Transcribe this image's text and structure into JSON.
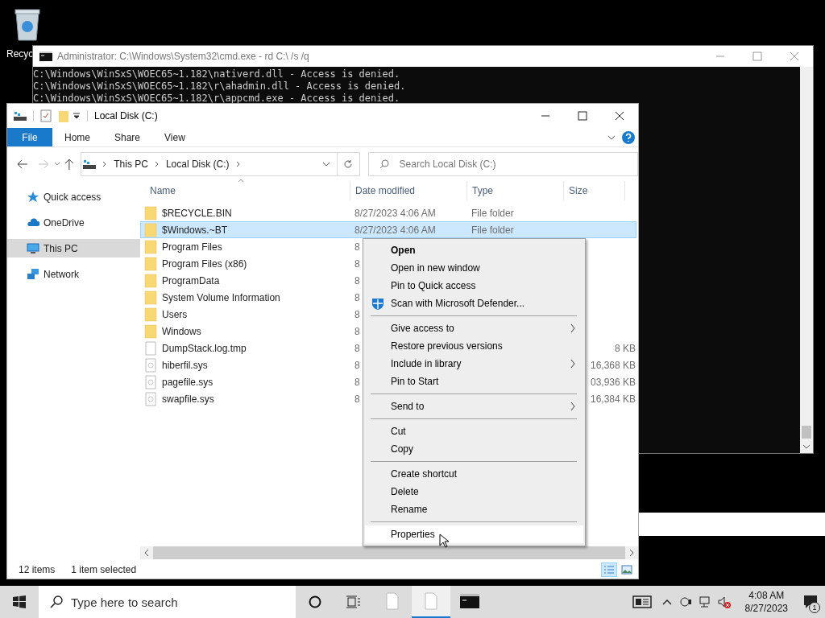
{
  "desktop": {
    "icons": [
      {
        "label": "Recyc"
      }
    ]
  },
  "console": {
    "title": "Administrator: C:\\Windows\\System32\\cmd.exe - rd  C:\\ /s /q",
    "lines": [
      "C:\\Windows\\WinSxS\\WOEC65~1.182\\nativerd.dll - Access is denied.",
      "C:\\Windows\\WinSxS\\WOEC65~1.182\\r\\ahadmin.dll - Access is denied.",
      "C:\\Windows\\WinSxS\\WOEC65~1.182\\r\\appcmd.exe - Access is denied."
    ]
  },
  "explorer": {
    "title": "Local Disk (C:)",
    "ribbon_tabs": [
      {
        "label": "File",
        "selected": true
      },
      {
        "label": "Home",
        "selected": false
      },
      {
        "label": "Share",
        "selected": false
      },
      {
        "label": "View",
        "selected": false
      }
    ],
    "breadcrumb": [
      "This PC",
      "Local Disk (C:)"
    ],
    "search": {
      "placeholder": "Search Local Disk (C:)"
    },
    "nav": [
      {
        "label": "Quick access",
        "kind": "star",
        "selected": false
      },
      {
        "label": "OneDrive",
        "kind": "cloud",
        "selected": false
      },
      {
        "label": "This PC",
        "kind": "pc",
        "selected": true
      },
      {
        "label": "Network",
        "kind": "network",
        "selected": false
      }
    ],
    "columns": [
      "Name",
      "Date modified",
      "Type",
      "Size"
    ],
    "rows": [
      {
        "name": "$RECYCLE.BIN",
        "kind": "folder",
        "date": "8/27/2023 4:06 AM",
        "type": "File folder",
        "size": "",
        "selected": false
      },
      {
        "name": "$Windows.~BT",
        "kind": "folder",
        "date": "8/27/2023 4:06 AM",
        "type": "File folder",
        "size": "",
        "selected": true
      },
      {
        "name": "Program Files",
        "kind": "folder",
        "date": "8",
        "type": "",
        "size": "",
        "selected": false
      },
      {
        "name": "Program Files (x86)",
        "kind": "folder",
        "date": "8",
        "type": "",
        "size": "",
        "selected": false
      },
      {
        "name": "ProgramData",
        "kind": "folder",
        "date": "8",
        "type": "",
        "size": "",
        "selected": false
      },
      {
        "name": "System Volume Information",
        "kind": "folder",
        "date": "8",
        "type": "",
        "size": "",
        "selected": false
      },
      {
        "name": "Users",
        "kind": "folder",
        "date": "8",
        "type": "",
        "size": "",
        "selected": false
      },
      {
        "name": "Windows",
        "kind": "folder",
        "date": "8",
        "type": "",
        "size": "",
        "selected": false
      },
      {
        "name": "DumpStack.log.tmp",
        "kind": "file",
        "date": "8",
        "type": "",
        "size": "8 KB",
        "selected": false
      },
      {
        "name": "hiberfil.sys",
        "kind": "system",
        "date": "8",
        "type": "",
        "size": "16,368 KB",
        "selected": false
      },
      {
        "name": "pagefile.sys",
        "kind": "system",
        "date": "8",
        "type": "",
        "size": "03,936 KB",
        "selected": false
      },
      {
        "name": "swapfile.sys",
        "kind": "system",
        "date": "8",
        "type": "",
        "size": "16,384 KB",
        "selected": false
      }
    ],
    "status": [
      "12 items",
      "1 item selected"
    ]
  },
  "context_menu": [
    {
      "kind": "item",
      "label": "Open",
      "default": true,
      "submenu": false,
      "shield": false,
      "hovered": false
    },
    {
      "kind": "item",
      "label": "Open in new window",
      "default": false,
      "submenu": false,
      "shield": false,
      "hovered": false
    },
    {
      "kind": "item",
      "label": "Pin to Quick access",
      "default": false,
      "submenu": false,
      "shield": false,
      "hovered": false
    },
    {
      "kind": "item",
      "label": "Scan with Microsoft Defender...",
      "default": false,
      "submenu": false,
      "shield": true,
      "hovered": false
    },
    {
      "kind": "separator"
    },
    {
      "kind": "item",
      "label": "Give access to",
      "default": false,
      "submenu": true,
      "shield": false,
      "hovered": false
    },
    {
      "kind": "item",
      "label": "Restore previous versions",
      "default": false,
      "submenu": false,
      "shield": false,
      "hovered": false
    },
    {
      "kind": "item",
      "label": "Include in library",
      "default": false,
      "submenu": true,
      "shield": false,
      "hovered": false
    },
    {
      "kind": "item",
      "label": "Pin to Start",
      "default": false,
      "submenu": false,
      "shield": false,
      "hovered": false
    },
    {
      "kind": "separator"
    },
    {
      "kind": "item",
      "label": "Send to",
      "default": false,
      "submenu": true,
      "shield": false,
      "hovered": false
    },
    {
      "kind": "separator"
    },
    {
      "kind": "item",
      "label": "Cut",
      "default": false,
      "submenu": false,
      "shield": false,
      "hovered": false
    },
    {
      "kind": "item",
      "label": "Copy",
      "default": false,
      "submenu": false,
      "shield": false,
      "hovered": false
    },
    {
      "kind": "separator"
    },
    {
      "kind": "item",
      "label": "Create shortcut",
      "default": false,
      "submenu": false,
      "shield": false,
      "hovered": false
    },
    {
      "kind": "item",
      "label": "Delete",
      "default": false,
      "submenu": false,
      "shield": false,
      "hovered": false
    },
    {
      "kind": "item",
      "label": "Rename",
      "default": false,
      "submenu": false,
      "shield": false,
      "hovered": false
    },
    {
      "kind": "separator"
    },
    {
      "kind": "item",
      "label": "Properties",
      "default": false,
      "submenu": false,
      "shield": false,
      "hovered": true
    }
  ],
  "taskbar": {
    "search": {
      "placeholder": "Type here to search"
    },
    "apps": [
      {
        "kind": "file",
        "active": false
      },
      {
        "kind": "file",
        "active": true
      },
      {
        "kind": "console",
        "active": false
      }
    ],
    "time": "4:08 AM",
    "date": "8/27/2023",
    "notifications": "1"
  }
}
